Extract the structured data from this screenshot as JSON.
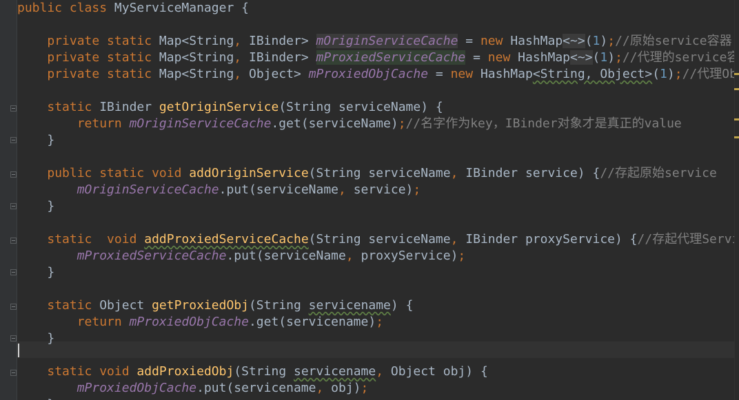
{
  "editor": {
    "lines": [
      {
        "segments": [
          [
            "kw",
            "public "
          ],
          [
            "kw",
            "class "
          ],
          [
            "pl",
            "MyServiceManager {"
          ]
        ]
      },
      {
        "segments": []
      },
      {
        "segments": [
          [
            "pl",
            "    "
          ],
          [
            "kw",
            "private static "
          ],
          [
            "pl",
            "Map<String"
          ],
          [
            "kw",
            ", "
          ],
          [
            "pl",
            "IBinder> "
          ],
          [
            "fld-hl",
            "mOriginServiceCache"
          ],
          [
            "pl",
            " = "
          ],
          [
            "kw",
            "new "
          ],
          [
            "pl",
            "HashMap"
          ],
          [
            "hl",
            "<~>"
          ],
          [
            "pl",
            "("
          ],
          [
            "num",
            "1"
          ],
          [
            "pl",
            ")"
          ],
          [
            "kw",
            ";"
          ],
          [
            "cm",
            "//原始service容器"
          ]
        ]
      },
      {
        "segments": [
          [
            "pl",
            "    "
          ],
          [
            "kw",
            "private static "
          ],
          [
            "pl",
            "Map<String"
          ],
          [
            "kw",
            ", "
          ],
          [
            "pl",
            "IBinder> "
          ],
          [
            "fld-usage",
            "mProxiedServiceCache"
          ],
          [
            "pl",
            " = "
          ],
          [
            "kw",
            "new "
          ],
          [
            "pl",
            "HashMap"
          ],
          [
            "hl",
            "<~>"
          ],
          [
            "pl",
            "("
          ],
          [
            "num",
            "1"
          ],
          [
            "pl",
            ")"
          ],
          [
            "kw",
            ";"
          ],
          [
            "cm",
            "//代理的service容器"
          ]
        ]
      },
      {
        "segments": [
          [
            "pl",
            "    "
          ],
          [
            "kw",
            "private static "
          ],
          [
            "pl",
            "Map<String"
          ],
          [
            "kw",
            ", "
          ],
          [
            "pl",
            "Object> "
          ],
          [
            "fld",
            "mProxiedObjCache"
          ],
          [
            "pl",
            " = "
          ],
          [
            "kw",
            "new "
          ],
          [
            "pl",
            "HashMap"
          ],
          [
            "wavy",
            "<String, Object>"
          ],
          [
            "pl",
            "("
          ],
          [
            "num",
            "1"
          ],
          [
            "pl",
            ")"
          ],
          [
            "kw",
            ";"
          ],
          [
            "cm",
            "//代理Object容器"
          ]
        ]
      },
      {
        "segments": []
      },
      {
        "segments": [
          [
            "pl",
            "    "
          ],
          [
            "kw",
            "static "
          ],
          [
            "pl",
            "IBinder "
          ],
          [
            "fn",
            "getOriginService"
          ],
          [
            "pl",
            "(String serviceName) {"
          ]
        ]
      },
      {
        "segments": [
          [
            "pl",
            "        "
          ],
          [
            "kw",
            "return "
          ],
          [
            "fld",
            "mOriginServiceCache"
          ],
          [
            "pl",
            ".get(serviceName)"
          ],
          [
            "kw",
            ";"
          ],
          [
            "cm",
            "//名字作为key，IBinder对象才是真正的value"
          ]
        ]
      },
      {
        "segments": [
          [
            "pl",
            "    }"
          ]
        ]
      },
      {
        "segments": []
      },
      {
        "segments": [
          [
            "pl",
            "    "
          ],
          [
            "kw",
            "public static void "
          ],
          [
            "fn",
            "addOriginService"
          ],
          [
            "pl",
            "(String serviceName"
          ],
          [
            "kw",
            ", "
          ],
          [
            "pl",
            "IBinder service) {"
          ],
          [
            "cm",
            "//存起原始service"
          ]
        ]
      },
      {
        "segments": [
          [
            "pl",
            "        "
          ],
          [
            "fld",
            "mOriginServiceCache"
          ],
          [
            "pl",
            ".put(serviceName"
          ],
          [
            "kw",
            ", "
          ],
          [
            "pl",
            "service)"
          ],
          [
            "kw",
            ";"
          ]
        ]
      },
      {
        "segments": [
          [
            "pl",
            "    }"
          ]
        ]
      },
      {
        "segments": []
      },
      {
        "segments": [
          [
            "pl",
            "    "
          ],
          [
            "kw",
            "static  void "
          ],
          [
            "fn-wavy",
            "addProxiedServiceCache"
          ],
          [
            "pl",
            "(String serviceName"
          ],
          [
            "kw",
            ", "
          ],
          [
            "pl",
            "IBinder proxyService) {"
          ],
          [
            "cm",
            "//存起代理Service"
          ]
        ]
      },
      {
        "segments": [
          [
            "pl",
            "        "
          ],
          [
            "fld",
            "mProxiedServiceCache"
          ],
          [
            "pl",
            ".put(serviceName"
          ],
          [
            "kw",
            ", "
          ],
          [
            "pl",
            "proxyService)"
          ],
          [
            "kw",
            ";"
          ]
        ]
      },
      {
        "segments": [
          [
            "pl",
            "    }"
          ]
        ]
      },
      {
        "segments": []
      },
      {
        "segments": [
          [
            "pl",
            "    "
          ],
          [
            "kw",
            "static "
          ],
          [
            "pl",
            "Object "
          ],
          [
            "fn",
            "getProxiedObj"
          ],
          [
            "pl",
            "(String "
          ],
          [
            "pl-wavy",
            "servicename"
          ],
          [
            "pl",
            ") {"
          ]
        ]
      },
      {
        "segments": [
          [
            "pl",
            "        "
          ],
          [
            "kw",
            "return "
          ],
          [
            "fld",
            "mProxiedObjCache"
          ],
          [
            "pl",
            ".get(servicename)"
          ],
          [
            "kw",
            ";"
          ]
        ]
      },
      {
        "segments": [
          [
            "pl",
            "    }"
          ]
        ]
      },
      {
        "segments": []
      },
      {
        "segments": [
          [
            "pl",
            "    "
          ],
          [
            "kw",
            "static void "
          ],
          [
            "fn",
            "addProxiedObj"
          ],
          [
            "pl",
            "(String "
          ],
          [
            "pl-wavy",
            "servicename"
          ],
          [
            "kw",
            ", "
          ],
          [
            "pl",
            "Object obj) {"
          ]
        ]
      },
      {
        "segments": [
          [
            "pl",
            "        "
          ],
          [
            "fld",
            "mProxiedObjCache"
          ],
          [
            "pl",
            ".put(servicename"
          ],
          [
            "kw",
            ", "
          ],
          [
            "pl",
            "obj)"
          ],
          [
            "kw",
            ";"
          ]
        ]
      },
      {
        "segments": [
          [
            "pl",
            "    }"
          ]
        ]
      }
    ]
  },
  "colors": {
    "background": "#2b2b2b",
    "keyword": "#cc7832",
    "method": "#ffc66d",
    "field": "#9876aa",
    "number": "#6897bb",
    "comment": "#808080",
    "plain": "#a9b7c6"
  }
}
